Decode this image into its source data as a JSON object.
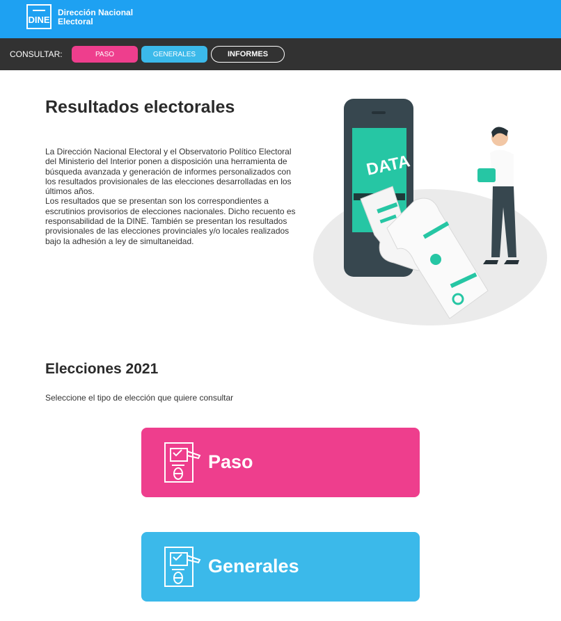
{
  "header": {
    "logo_text": "DINE",
    "org_line1": "Dirección Nacional",
    "org_line2": "Electoral"
  },
  "nav": {
    "label": "CONSULTAR:",
    "items": [
      {
        "label": "PASO",
        "color": "#ee3e8d"
      },
      {
        "label": "GENERALES",
        "color": "#3bb9ea"
      },
      {
        "label": "INFORMES"
      }
    ]
  },
  "intro": {
    "title": "Resultados electorales",
    "paragraph1": "La Dirección Nacional Electoral y el Observatorio Político Electoral del Ministerio del Interior ponen a disposición una herramienta de búsqueda avanzada y generación de informes personalizados con los resultados provisionales de las elecciones desarrolladas en los últimos años.",
    "paragraph2": "Los resultados que se presentan son los correspondientes a escrutinios provisorios de elecciones nacionales. Dicho recuento es responsabilidad de la DINE. También se presentan los resultados provisionales de las elecciones provinciales y/o locales realizados bajo la adhesión a ley de simultaneidad."
  },
  "illustration": {
    "screen_text": "DATA",
    "icon": "data-report-illustration"
  },
  "elections": {
    "title": "Elecciones 2021",
    "instruction": "Seleccione el tipo de elección que quiere consultar",
    "options": [
      {
        "label": "Paso",
        "color": "#ee3e8d",
        "icon": "ballot-box-icon"
      },
      {
        "label": "Generales",
        "color": "#3bb9ea",
        "icon": "ballot-box-icon"
      }
    ]
  }
}
